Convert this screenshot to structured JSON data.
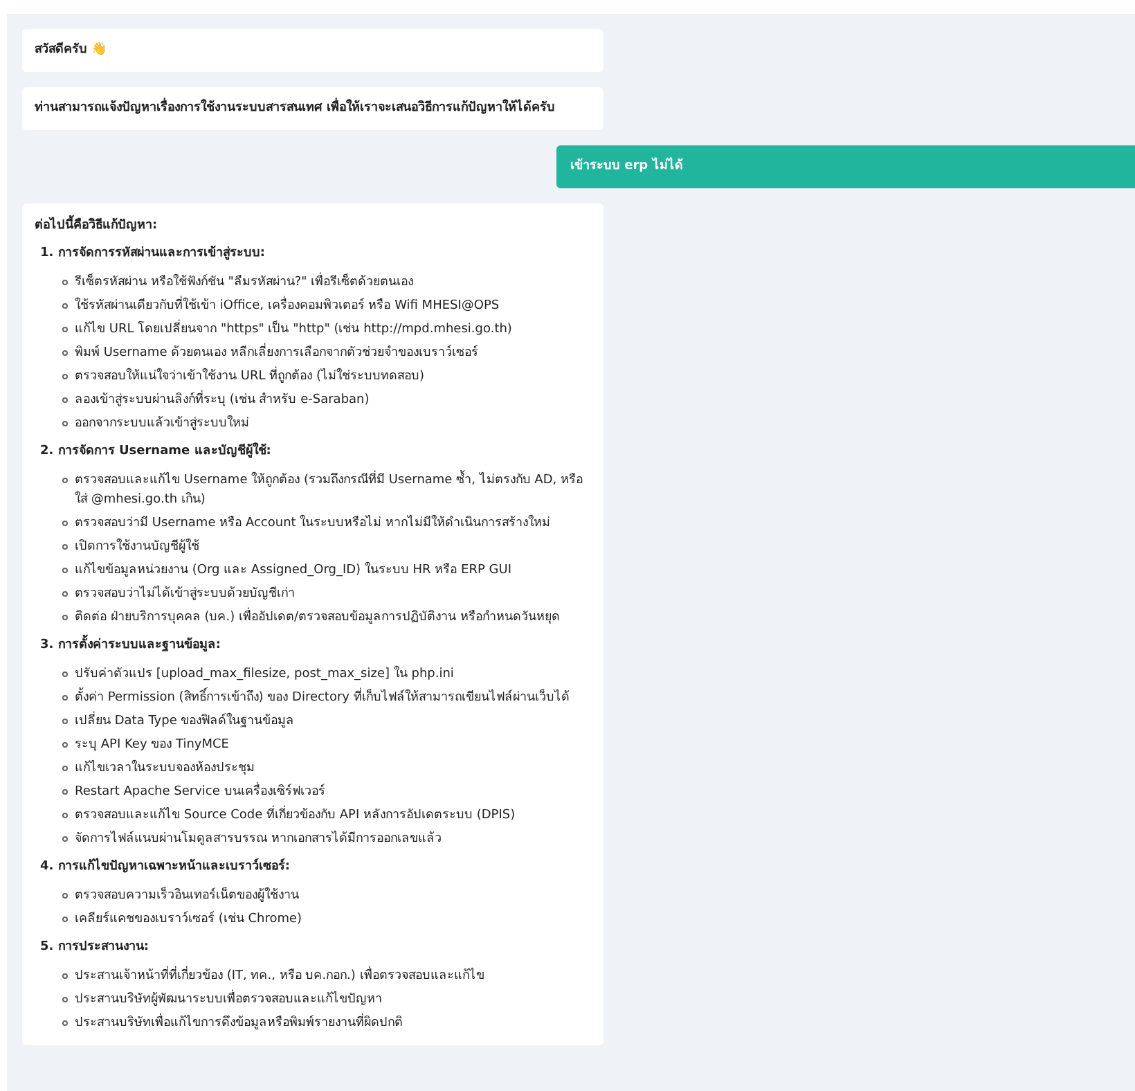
{
  "messages": [
    {
      "kind": "bot",
      "text": "สวัสดีครับ 👋"
    },
    {
      "kind": "bot",
      "text": "ท่านสามารถแจ้งปัญหาเรื่องการใช้งานระบบสารสนเทศ เพื่อให้เราจะเสนอวิธีการแก้ปัญหาให้ได้ครับ"
    },
    {
      "kind": "user",
      "text": "เข้าระบบ erp ไม่ได้"
    },
    {
      "kind": "steps",
      "intro": "ต่อไปนี้คือวิธีแก้ปัญหา:",
      "sections": [
        {
          "title": "1. การจัดการรหัสผ่านและการเข้าสู่ระบบ:",
          "items": [
            "รีเซ็ตรหัสผ่าน หรือใช้ฟังก์ชัน \"ลืมรหัสผ่าน?\" เพื่อรีเซ็ตด้วยตนเอง",
            "ใช้รหัสผ่านเดียวกับที่ใช้เข้า iOffice, เครื่องคอมพิวเตอร์ หรือ Wifi MHESI@OPS",
            "แก้ไข URL โดยเปลี่ยนจาก \"https\" เป็น \"http\" (เช่น http://mpd.mhesi.go.th)",
            "พิมพ์ Username ด้วยตนเอง หลีกเลี่ยงการเลือกจากตัวช่วยจำของเบราว์เซอร์",
            "ตรวจสอบให้แน่ใจว่าเข้าใช้งาน URL ที่ถูกต้อง (ไม่ใช่ระบบทดสอบ)",
            "ลองเข้าสู่ระบบผ่านลิงก์ที่ระบุ (เช่น สำหรับ e-Saraban)",
            "ออกจากระบบแล้วเข้าสู่ระบบใหม่"
          ]
        },
        {
          "title": "2. การจัดการ Username และบัญชีผู้ใช้:",
          "items": [
            "ตรวจสอบและแก้ไข Username ให้ถูกต้อง (รวมถึงกรณีที่มี Username ซ้ำ, ไม่ตรงกับ AD, หรือใส่ @mhesi.go.th เกิน)",
            "ตรวจสอบว่ามี Username หรือ Account ในระบบหรือไม่ หากไม่มีให้ดำเนินการสร้างใหม่",
            "เปิดการใช้งานบัญชีผู้ใช้",
            "แก้ไขข้อมูลหน่วยงาน (Org และ Assigned_Org_ID) ในระบบ HR หรือ ERP GUI",
            "ตรวจสอบว่าไม่ได้เข้าสู่ระบบด้วยบัญชีเก่า",
            "ติดต่อ ฝ่ายบริการบุคคล (บค.) เพื่ออัปเดต/ตรวจสอบข้อมูลการปฏิบัติงาน หรือกำหนดวันหยุด"
          ]
        },
        {
          "title": "3. การตั้งค่าระบบและฐานข้อมูล:",
          "items": [
            "ปรับค่าตัวแปร [upload_max_filesize, post_max_size] ใน php.ini",
            "ตั้งค่า Permission (สิทธิ์การเข้าถึง) ของ Directory ที่เก็บไฟล์ให้สามารถเขียนไฟล์ผ่านเว็บได้",
            "เปลี่ยน Data Type ของฟิลด์ในฐานข้อมูล",
            "ระบุ API Key ของ TinyMCE",
            "แก้ไขเวลาในระบบจองห้องประชุม",
            "Restart Apache Service บนเครื่องเซิร์ฟเวอร์",
            "ตรวจสอบและแก้ไข Source Code ที่เกี่ยวข้องกับ API หลังการอัปเดตระบบ (DPIS)",
            "จัดการไฟล์แนบผ่านโมดูลสารบรรณ หากเอกสารได้มีการออกเลขแล้ว"
          ]
        },
        {
          "title": "4. การแก้ไขปัญหาเฉพาะหน้าและเบราว์เซอร์:",
          "items": [
            "ตรวจสอบความเร็วอินเทอร์เน็ตของผู้ใช้งาน",
            "เคลียร์แคชของเบราว์เซอร์ (เช่น Chrome)"
          ]
        },
        {
          "title": "5. การประสานงาน:",
          "items": [
            "ประสานเจ้าหน้าที่ที่เกี่ยวข้อง (IT, ทค., หรือ บค.กอก.) เพื่อตรวจสอบและแก้ไข",
            "ประสานบริษัทผู้พัฒนาระบบเพื่อตรวจสอบและแก้ไขปัญหา",
            "ประสานบริษัทเพื่อแก้ไขการดึงข้อมูลหรือพิมพ์รายงานที่ผิดปกติ"
          ]
        }
      ]
    }
  ]
}
